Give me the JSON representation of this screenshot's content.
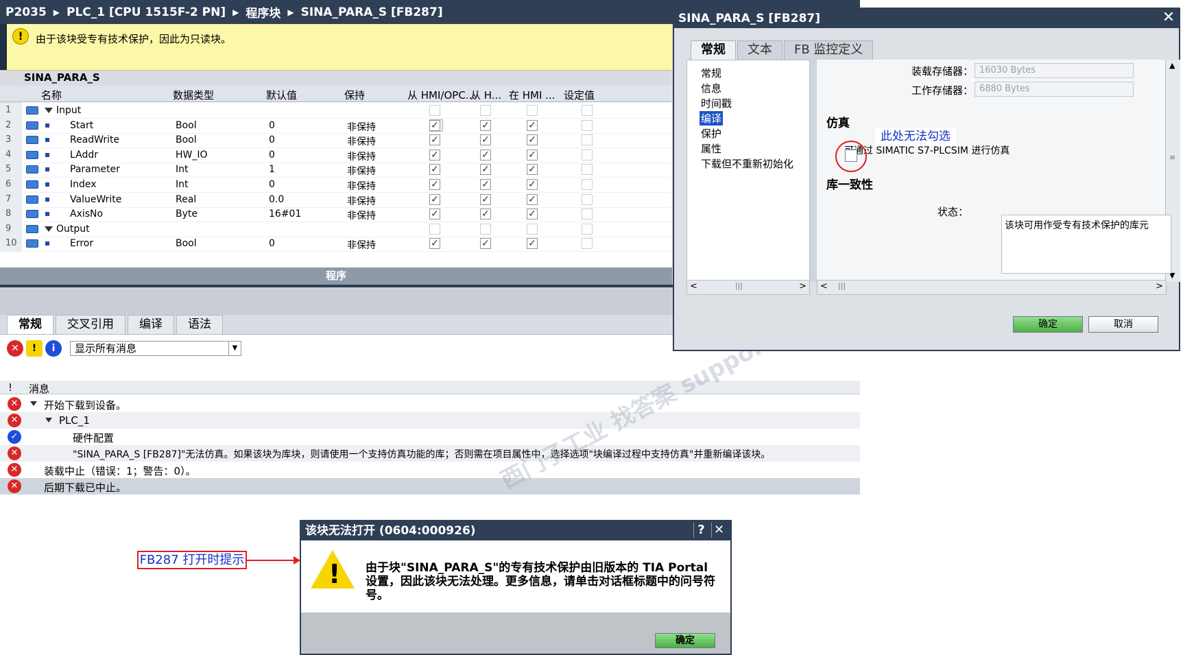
{
  "breadcrumb": [
    "P2035",
    "PLC_1 [CPU 1515F-2 PN]",
    "程序块",
    "SINA_PARA_S [FB287]"
  ],
  "breadcrumb_sep": "▶",
  "warning_text": "由于该块受专有技术保护，因此为只读块。",
  "block_name": "SINA_PARA_S",
  "table": {
    "headers": [
      "名称",
      "数据类型",
      "默认值",
      "保持",
      "从 HMI/OPC...",
      "从 H...",
      "在 HMI ...",
      "设定值"
    ],
    "rows": [
      {
        "num": "1",
        "name": "Input",
        "type": "",
        "default": "",
        "retain": "",
        "c1": "",
        "c2": "",
        "c3": "",
        "c4": ""
      },
      {
        "num": "2",
        "name": "Start",
        "type": "Bool",
        "default": "0",
        "retain": "非保持",
        "c1": "✓",
        "c2": "✓",
        "c3": "✓",
        "c4": ""
      },
      {
        "num": "3",
        "name": "ReadWrite",
        "type": "Bool",
        "default": "0",
        "retain": "非保持",
        "c1": "✓",
        "c2": "✓",
        "c3": "✓",
        "c4": ""
      },
      {
        "num": "4",
        "name": "LAddr",
        "type": "HW_IO",
        "default": "0",
        "retain": "非保持",
        "c1": "✓",
        "c2": "✓",
        "c3": "✓",
        "c4": ""
      },
      {
        "num": "5",
        "name": "Parameter",
        "type": "Int",
        "default": "1",
        "retain": "非保持",
        "c1": "✓",
        "c2": "✓",
        "c3": "✓",
        "c4": ""
      },
      {
        "num": "6",
        "name": "Index",
        "type": "Int",
        "default": "0",
        "retain": "非保持",
        "c1": "✓",
        "c2": "✓",
        "c3": "✓",
        "c4": ""
      },
      {
        "num": "7",
        "name": "ValueWrite",
        "type": "Real",
        "default": "0.0",
        "retain": "非保持",
        "c1": "✓",
        "c2": "✓",
        "c3": "✓",
        "c4": ""
      },
      {
        "num": "8",
        "name": "AxisNo",
        "type": "Byte",
        "default": "16#01",
        "retain": "非保持",
        "c1": "✓",
        "c2": "✓",
        "c3": "✓",
        "c4": ""
      },
      {
        "num": "9",
        "name": "Output",
        "type": "",
        "default": "",
        "retain": "",
        "c1": "",
        "c2": "",
        "c3": "",
        "c4": ""
      },
      {
        "num": "10",
        "name": "Error",
        "type": "Bool",
        "default": "0",
        "retain": "非保持",
        "c1": "✓",
        "c2": "✓",
        "c3": "✓",
        "c4": ""
      }
    ]
  },
  "program_label": "程序",
  "bottom_tabs": [
    "常规",
    "交叉引用",
    "编译",
    "语法"
  ],
  "toolbar_icons": {
    "error": "✕",
    "warning": "!",
    "info": "i"
  },
  "filter_value": "显示所有消息",
  "messages_header": {
    "bang": "!",
    "title": "消息"
  },
  "messages": [
    "开始下载到设备。",
    "PLC_1",
    "硬件配置",
    "\"SINA_PARA_S [FB287]\"无法仿真。如果该块为库块，则请使用一个支持仿真功能的库；否则需在项目属性中，选择选项\"块编译过程中支持仿真\"并重新编译该块。",
    "装载中止（错误：1；警告：0）。",
    "后期下载已中止。"
  ],
  "props_dialog": {
    "title": "SINA_PARA_S [FB287]",
    "close": "✕",
    "tabs": [
      "常规",
      "文本",
      "FB 监控定义"
    ],
    "nav": [
      "常规",
      "信息",
      "时间戳",
      "编译",
      "保护",
      "属性",
      "下载但不重新初始化"
    ],
    "load_memory_label": "装载存储器：",
    "load_memory_value": "16030 Bytes",
    "work_memory_label": "工作存储器：",
    "work_memory_value": "6880 Bytes",
    "simulation_title": "仿真",
    "simulation_option": "可通过 SIMATIC S7-PLCSIM 进行仿真",
    "cannot_check_note": "此处无法勾选",
    "library_title": "库一致性",
    "status_label": "状态：",
    "status_value": "该块可用作受专有技术保护的库元",
    "ok": "确定",
    "cancel": "取消"
  },
  "error_dialog": {
    "title": "该块无法打开 (0604:000926)",
    "help": "?",
    "close": "✕",
    "icon": "!",
    "message": "由于块\"SINA_PARA_S\"的专有技术保护由旧版本的 TIA Portal 设置，因此该块无法处理。更多信息，请单击对话框标题中的问号符号。",
    "ok": "确定"
  },
  "callout": "FB287 打开时提示",
  "watermark": "西门子工业 找答案 support.industry.siemens.com",
  "colors": {
    "title_bar": "#2f3f55",
    "warning_bg": "#fbf8a7",
    "error": "#d82929",
    "ok_button": "#62c05a",
    "annotation": "#e02020",
    "note_text": "#1432c8"
  }
}
